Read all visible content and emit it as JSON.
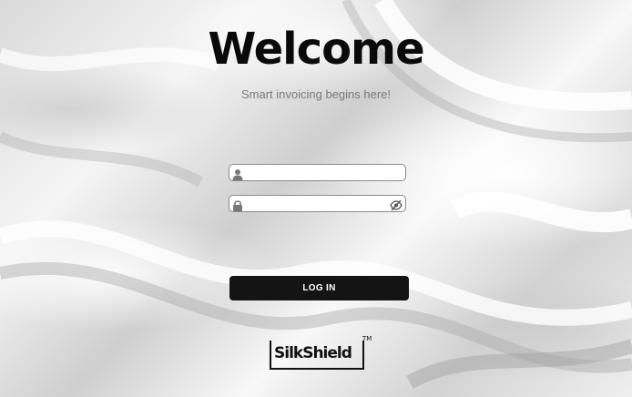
{
  "header": {
    "title": "Welcome",
    "subtitle": "Smart invoicing begins here!"
  },
  "form": {
    "username": {
      "value": "",
      "icon": "user-icon"
    },
    "password": {
      "value": "",
      "icon": "lock-icon",
      "toggle_icon": "eye-slash-icon"
    },
    "login_label": "LOG IN"
  },
  "brand": {
    "logo_text": "SilkShield",
    "trademark": "TM"
  },
  "colors": {
    "button_bg": "#141414",
    "button_text": "#ffffff",
    "title": "#0a0a0a",
    "subtitle": "#7a7a7a"
  }
}
